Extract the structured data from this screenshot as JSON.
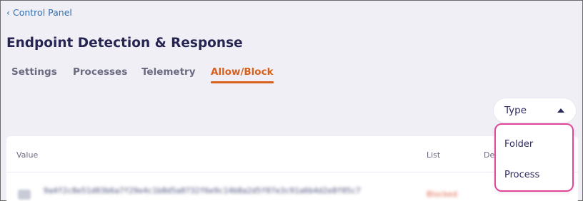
{
  "breadcrumb": {
    "chevron": "‹",
    "label": "Control Panel"
  },
  "page": {
    "title": "Endpoint Detection & Response"
  },
  "tabs": [
    {
      "label": "Settings",
      "active": false
    },
    {
      "label": "Processes",
      "active": false
    },
    {
      "label": "Telemetry",
      "active": false
    },
    {
      "label": "Allow/Block",
      "active": true
    }
  ],
  "filter": {
    "selected_label": "Type",
    "expanded": true,
    "options": [
      "Folder",
      "Process"
    ]
  },
  "table": {
    "columns": [
      "Value",
      "List",
      "De"
    ]
  },
  "colors": {
    "accent": "#d9601a",
    "link": "#2e6fb5",
    "highlight_border": "#e0479b"
  }
}
